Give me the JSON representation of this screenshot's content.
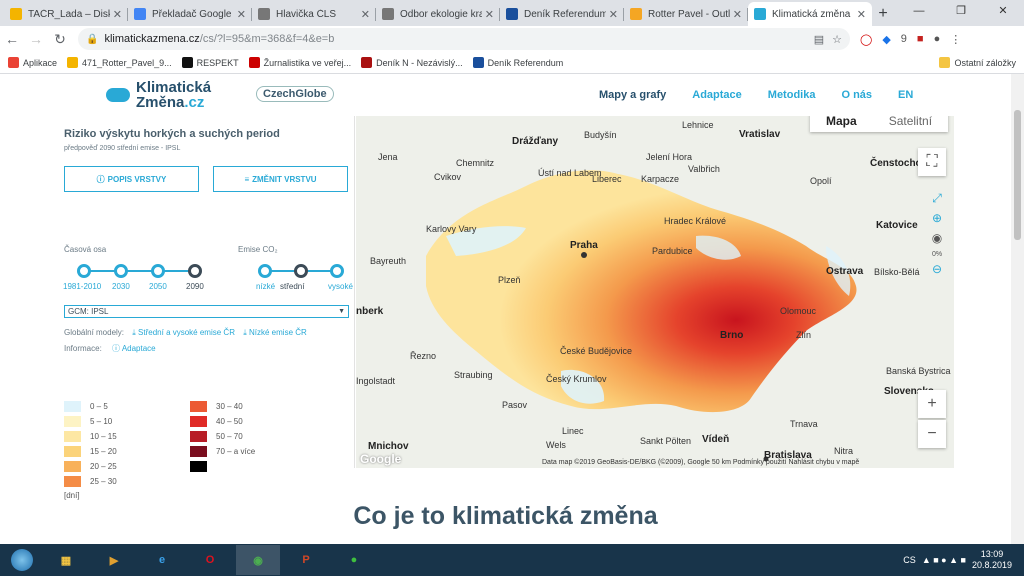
{
  "browser": {
    "tabs": [
      {
        "label": "TAČR_Lada – Disk G",
        "color": "#f4b400",
        "active": false
      },
      {
        "label": "Překladač Google",
        "color": "#4285f4",
        "active": false
      },
      {
        "label": "Hlavička ČLS",
        "color": "#777777",
        "active": false
      },
      {
        "label": "Odbor ekologie kra",
        "color": "#777777",
        "active": false
      },
      {
        "label": "Deník Referendum",
        "color": "#1a4f9c",
        "active": false
      },
      {
        "label": "Rotter Pavel - Outlo",
        "color": "#f5a623",
        "active": false
      },
      {
        "label": "Klimatická změna",
        "color": "#29a9d6",
        "active": true
      }
    ],
    "url_domain": "klimatickazmena.cz",
    "url_path": "/cs/?l=95&m=368&f=4&e=b",
    "bookmarks": [
      {
        "label": "Aplikace",
        "color": "#ea4335"
      },
      {
        "label": "471_Rotter_Pavel_9...",
        "color": "#f4b400"
      },
      {
        "label": "RESPEKT",
        "color": "#111111"
      },
      {
        "label": "Žurnalistika ve veřej...",
        "color": "#cc0000"
      },
      {
        "label": "Deník N - Nezávislý...",
        "color": "#aa1111"
      },
      {
        "label": "Deník Referendum",
        "color": "#1a4f9c"
      }
    ],
    "bookmarks_more": "Ostatní záložky"
  },
  "site": {
    "logo_line1": "Klimatická",
    "logo_line2a": "Změna",
    "logo_line2b": ".cz",
    "partner": "CzechGlobe",
    "nav": [
      "Mapy a grafy",
      "Adaptace",
      "Metodika",
      "O nás",
      "EN"
    ]
  },
  "panel": {
    "title": "Riziko výskytu horkých a suchých period",
    "subtitle": "předpověď 2090 střední emise - IPSL",
    "btn_describe": "POPIS VRSTVY",
    "btn_change": "ZMĚNIT VRSTVU",
    "time_axis_label": "Časová osa",
    "time_points": [
      "1981-2010",
      "2030",
      "2050",
      "2090"
    ],
    "time_selected": "2090",
    "emis_label": "Emise CO₂",
    "emis_points": [
      "nízké",
      "střední",
      "vysoké"
    ],
    "emis_selected": "střední",
    "gcm_value": "GCM: IPSL",
    "models_label": "Globální modely:",
    "models_link1": "Střední a vysoké emise ČR",
    "models_link2": "Nízké emise ČR",
    "info_label": "Informace:",
    "info_link": "Adaptace",
    "legend": [
      {
        "label": "0 – 5",
        "color": "#dff3fb"
      },
      {
        "label": "5 – 10",
        "color": "#fdf3c4"
      },
      {
        "label": "10 – 15",
        "color": "#fde7a3"
      },
      {
        "label": "15 – 20",
        "color": "#fbd37a"
      },
      {
        "label": "20 – 25",
        "color": "#f8b15a"
      },
      {
        "label": "25 – 30",
        "color": "#f48c46"
      },
      {
        "label": "30 – 40",
        "color": "#ec5a34"
      },
      {
        "label": "40 – 50",
        "color": "#e02a26"
      },
      {
        "label": "50 – 70",
        "color": "#b81c26"
      },
      {
        "label": "70 – a více",
        "color": "#7a0d1e"
      },
      {
        "label": "",
        "color": "#000000"
      }
    ],
    "legend_unit": "[dní]"
  },
  "map": {
    "type_map": "Mapa",
    "type_sat": "Satelitní",
    "zoom_pct": "0%",
    "attribution": "Data map ©2019 GeoBasis-DE/BKG (©2009), Google    50 km    Podmínky použití    Nahlásit chybu v mapě",
    "google": "Google",
    "places": [
      {
        "name": "Lehnice",
        "big": false
      },
      {
        "name": "Vratislav",
        "big": true
      },
      {
        "name": "Drážďany",
        "big": true
      },
      {
        "name": "Budyšín",
        "big": false
      },
      {
        "name": "Jena",
        "big": false
      },
      {
        "name": "Chemnitz",
        "big": false
      },
      {
        "name": "Jelení Hora",
        "big": false
      },
      {
        "name": "Čenstochová",
        "big": true
      },
      {
        "name": "Cvikov",
        "big": false
      },
      {
        "name": "Ústí nad Labem",
        "big": false
      },
      {
        "name": "Liberec",
        "big": false
      },
      {
        "name": "Karpacze",
        "big": false
      },
      {
        "name": "Valbřich",
        "big": false
      },
      {
        "name": "Opolí",
        "big": false
      },
      {
        "name": "Hradec Králové",
        "big": false
      },
      {
        "name": "Karlovy Vary",
        "big": false
      },
      {
        "name": "Praha",
        "big": true
      },
      {
        "name": "Pardubice",
        "big": false
      },
      {
        "name": "Katovice",
        "big": true
      },
      {
        "name": "Bayreuth",
        "big": false
      },
      {
        "name": "Ostrava",
        "big": true
      },
      {
        "name": "Bílsko-Bělá",
        "big": false
      },
      {
        "name": "Plzeň",
        "big": false
      },
      {
        "name": "Olomouc",
        "big": false
      },
      {
        "name": "Zlín",
        "big": false
      },
      {
        "name": "Brno",
        "big": true
      },
      {
        "name": "Řezno",
        "big": false
      },
      {
        "name": "České Budějovice",
        "big": false
      },
      {
        "name": "Ingolstadt",
        "big": false
      },
      {
        "name": "Straubing",
        "big": false
      },
      {
        "name": "Český Krumlov",
        "big": false
      },
      {
        "name": "Banská Bystrica",
        "big": false
      },
      {
        "name": "Slovensko",
        "big": true
      },
      {
        "name": "Pasov",
        "big": false
      },
      {
        "name": "Trnava",
        "big": false
      },
      {
        "name": "Linec",
        "big": false
      },
      {
        "name": "Mnichov",
        "big": true
      },
      {
        "name": "Wels",
        "big": false
      },
      {
        "name": "Sankt Pölten",
        "big": false
      },
      {
        "name": "Vídeň",
        "big": true
      },
      {
        "name": "Bratislava",
        "big": true
      },
      {
        "name": "Nitra",
        "big": false
      },
      {
        "name": "nberk",
        "big": true
      }
    ]
  },
  "heading": "Co je to klimatická změna",
  "taskbar": {
    "lang": "CS",
    "time": "13:09",
    "date": "20.8.2019"
  }
}
